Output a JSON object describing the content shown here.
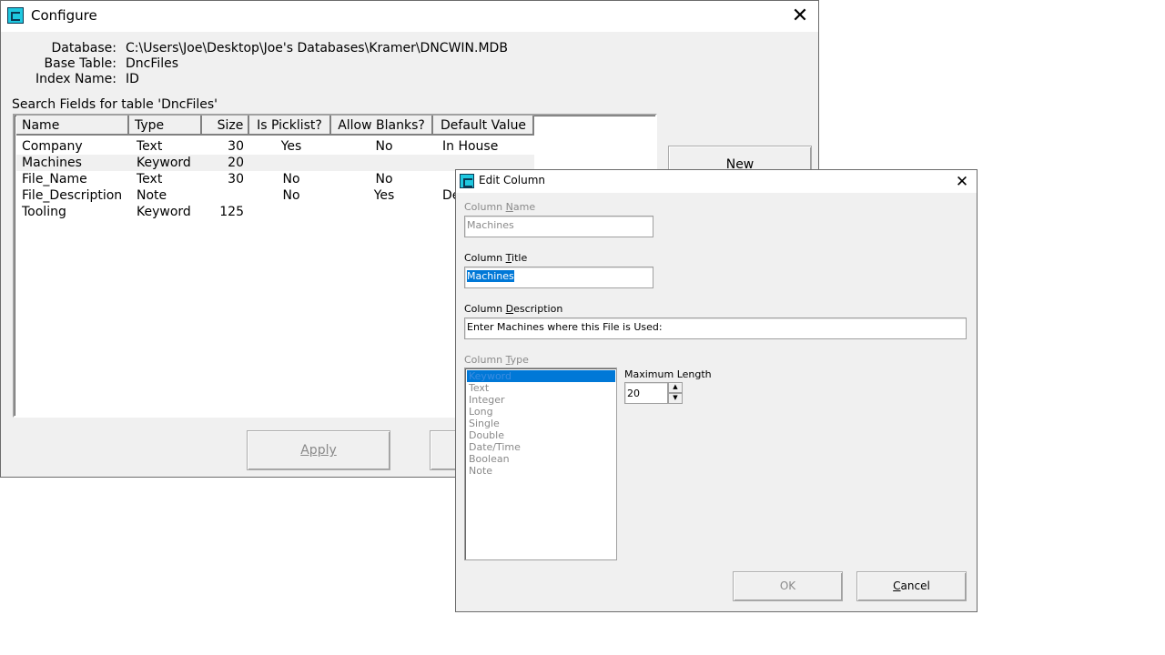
{
  "configure": {
    "title": "Configure",
    "database_label": "Database:",
    "database_value": "C:\\Users\\Joe\\Desktop\\Joe's Databases\\Kramer\\DNCWIN.MDB",
    "base_table_label": "Base Table:",
    "base_table_value": "DncFiles",
    "index_name_label": "Index Name:",
    "index_name_value": "ID",
    "search_fields_label": "Search Fields for table 'DncFiles'",
    "columns": [
      "Name",
      "Type",
      "Size",
      "Is Picklist?",
      "Allow Blanks?",
      "Default Value"
    ],
    "rows": [
      {
        "name": "Company",
        "type": "Text",
        "size": "30",
        "picklist": "Yes",
        "blanks": "No",
        "default": "In House"
      },
      {
        "name": "Machines",
        "type": "Keyword",
        "size": "20",
        "picklist": "",
        "blanks": "",
        "default": ""
      },
      {
        "name": "File_Name",
        "type": "Text",
        "size": "30",
        "picklist": "No",
        "blanks": "No",
        "default": ""
      },
      {
        "name": "File_Description",
        "type": "Note",
        "size": "",
        "picklist": "No",
        "blanks": "Yes",
        "default": "De"
      },
      {
        "name": "Tooling",
        "type": "Keyword",
        "size": "125",
        "picklist": "",
        "blanks": "",
        "default": ""
      }
    ],
    "new_button": "New",
    "apply_button": "Apply"
  },
  "edit_column": {
    "title": "Edit Column",
    "column_name_label_pre": "Column ",
    "column_name_label_u": "N",
    "column_name_label_post": "ame",
    "column_name_value": "Machines",
    "column_title_label_pre": "Column ",
    "column_title_label_u": "T",
    "column_title_label_post": "itle",
    "column_title_value": "Machines",
    "column_desc_label_pre": "Column ",
    "column_desc_label_u": "D",
    "column_desc_label_post": "escription",
    "column_desc_value": "Enter Machines where this File is Used:",
    "column_type_label_pre": "Column ",
    "column_type_label_u": "T",
    "column_type_label_post": "ype",
    "types": [
      "Keyword",
      "Text",
      "Integer",
      "Long",
      "Single",
      "Double",
      "Date/Time",
      "Boolean",
      "Note"
    ],
    "selected_type": "Keyword",
    "max_length_label": "Maximum Length",
    "max_length_value": "20",
    "ok_button": "OK",
    "cancel_button_pre": "",
    "cancel_button_u": "C",
    "cancel_button_post": "ancel"
  }
}
